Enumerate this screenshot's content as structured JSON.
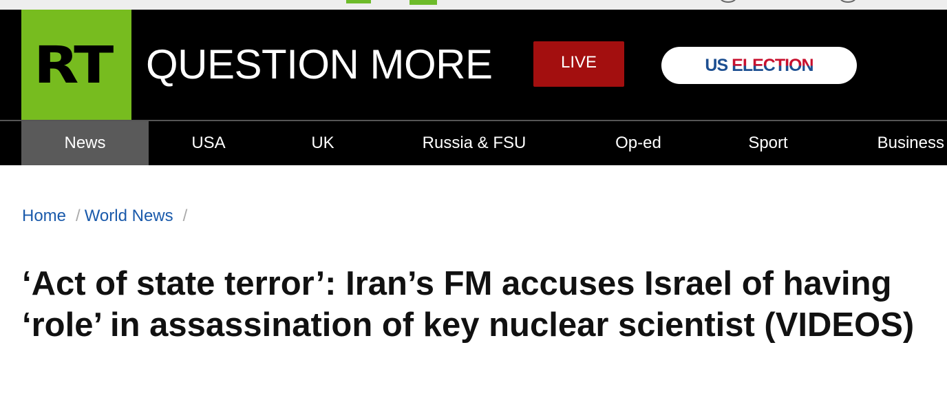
{
  "header": {
    "logo_text": "RT",
    "brand_text": "QUESTION MORE",
    "live_label": "LIVE",
    "election_us": "US",
    "election_rest": "ELECTION"
  },
  "nav": {
    "items": [
      {
        "label": "News",
        "active": true
      },
      {
        "label": "USA",
        "active": false
      },
      {
        "label": "UK",
        "active": false
      },
      {
        "label": "Russia & FSU",
        "active": false
      },
      {
        "label": "Op-ed",
        "active": false
      },
      {
        "label": "Sport",
        "active": false
      },
      {
        "label": "Business",
        "active": false
      }
    ]
  },
  "breadcrumb": {
    "items": [
      "Home",
      "World News"
    ],
    "separator": "/"
  },
  "article": {
    "headline": "‘Act of state terror’: Iran’s FM accuses Israel of having ‘role’ in assassination of key nuclear scientist (VIDEOS)"
  },
  "colors": {
    "logo_green": "#77bc1f",
    "live_red": "#a30f0f",
    "nav_active": "#5a5a5a",
    "link_blue": "#1a5aab",
    "election_blue": "#1d4f91",
    "election_red": "#c8102e"
  }
}
